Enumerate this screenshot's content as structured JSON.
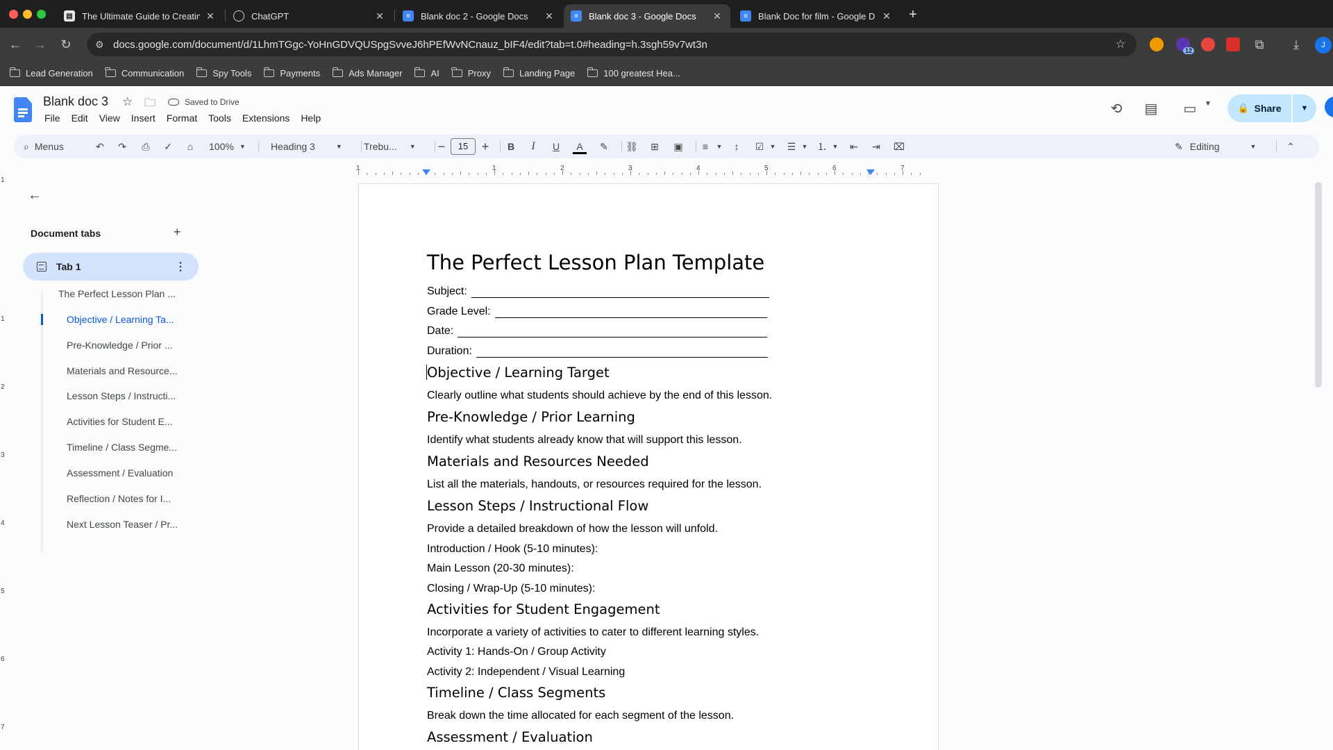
{
  "browser": {
    "tabs": [
      {
        "title": "The Ultimate Guide to Creatin",
        "icon": "guide-icon",
        "active": false
      },
      {
        "title": "ChatGPT",
        "icon": "chatgpt-icon",
        "active": false
      },
      {
        "title": "Blank doc 2 - Google Docs",
        "icon": "docs-icon",
        "active": false
      },
      {
        "title": "Blank doc 3 - Google Docs",
        "icon": "docs-icon",
        "active": true
      },
      {
        "title": "Blank Doc for film - Google D",
        "icon": "docs-icon",
        "active": false
      }
    ],
    "url": "docs.google.com/document/d/1LhmTGgc-YoHnGDVQUSpgSvveJ6hPEfWvNCnauz_bIF4/edit?tab=t.0#heading=h.3sgh59v7wt3n",
    "extension_badge": "12",
    "profile_initial": "J",
    "bookmarks": [
      "Lead Generation",
      "Communication",
      "Spy Tools",
      "Payments",
      "Ads Manager",
      "AI",
      "Proxy",
      "Landing Page",
      "100 greatest Hea..."
    ]
  },
  "docs": {
    "title": "Blank doc 3",
    "save_status": "Saved to Drive",
    "menu": [
      "File",
      "Edit",
      "View",
      "Insert",
      "Format",
      "Tools",
      "Extensions",
      "Help"
    ],
    "share_label": "Share"
  },
  "format_toolbar": {
    "menus_label": "Menus",
    "zoom": "100%",
    "style": "Heading 3",
    "font": "Trebu...",
    "font_size": "15",
    "mode": "Editing"
  },
  "ruler": {
    "labels": [
      "1",
      "1",
      "2",
      "3",
      "4",
      "5",
      "6",
      "7"
    ],
    "vertical_labels": [
      "1",
      "1",
      "2",
      "3",
      "4",
      "5",
      "6",
      "7"
    ]
  },
  "sidebar": {
    "heading": "Document tabs",
    "tab_name": "Tab 1",
    "outline": [
      {
        "label": "The Perfect Lesson Plan ...",
        "level": 1,
        "active": false
      },
      {
        "label": "Objective / Learning Ta...",
        "level": 3,
        "active": true
      },
      {
        "label": "Pre-Knowledge / Prior ...",
        "level": 3,
        "active": false
      },
      {
        "label": "Materials and Resource...",
        "level": 3,
        "active": false
      },
      {
        "label": "Lesson Steps / Instructi...",
        "level": 3,
        "active": false
      },
      {
        "label": "Activities for Student E...",
        "level": 3,
        "active": false
      },
      {
        "label": "Timeline / Class Segme...",
        "level": 3,
        "active": false
      },
      {
        "label": "Assessment / Evaluation",
        "level": 3,
        "active": false
      },
      {
        "label": "Reflection / Notes for I...",
        "level": 3,
        "active": false
      },
      {
        "label": "Next Lesson Teaser / Pr...",
        "level": 3,
        "active": false
      }
    ]
  },
  "document": {
    "title": "The Perfect Lesson Plan Template",
    "fields": [
      "Subject:",
      "Grade Level:",
      "Date:",
      "Duration:"
    ],
    "sections": [
      {
        "heading": "Objective / Learning Target",
        "lines": [
          "Clearly outline what students should achieve by the end of this lesson."
        ]
      },
      {
        "heading": "Pre-Knowledge / Prior Learning",
        "lines": [
          "Identify what students already know that will support this lesson."
        ]
      },
      {
        "heading": "Materials and Resources Needed",
        "lines": [
          "List all the materials, handouts, or resources required for the lesson."
        ]
      },
      {
        "heading": "Lesson Steps / Instructional Flow",
        "lines": [
          "Provide a detailed breakdown of how the lesson will unfold.",
          "Introduction / Hook (5-10 minutes):",
          "Main Lesson (20-30 minutes):",
          "Closing / Wrap-Up (5-10 minutes):"
        ]
      },
      {
        "heading": "Activities for Student Engagement",
        "lines": [
          "Incorporate a variety of activities to cater to different learning styles.",
          "Activity 1: Hands-On / Group Activity",
          "Activity 2: Independent / Visual Learning"
        ]
      },
      {
        "heading": "Timeline / Class Segments",
        "lines": [
          "Break down the time allocated for each segment of the lesson."
        ]
      },
      {
        "heading": "Assessment / Evaluation",
        "lines": []
      }
    ]
  },
  "colors": {
    "accent": "#0b57d0",
    "share_bg": "#c2e7ff",
    "tab_highlight": "#d3e3fd",
    "toolbar_bg": "#edf2fa"
  }
}
